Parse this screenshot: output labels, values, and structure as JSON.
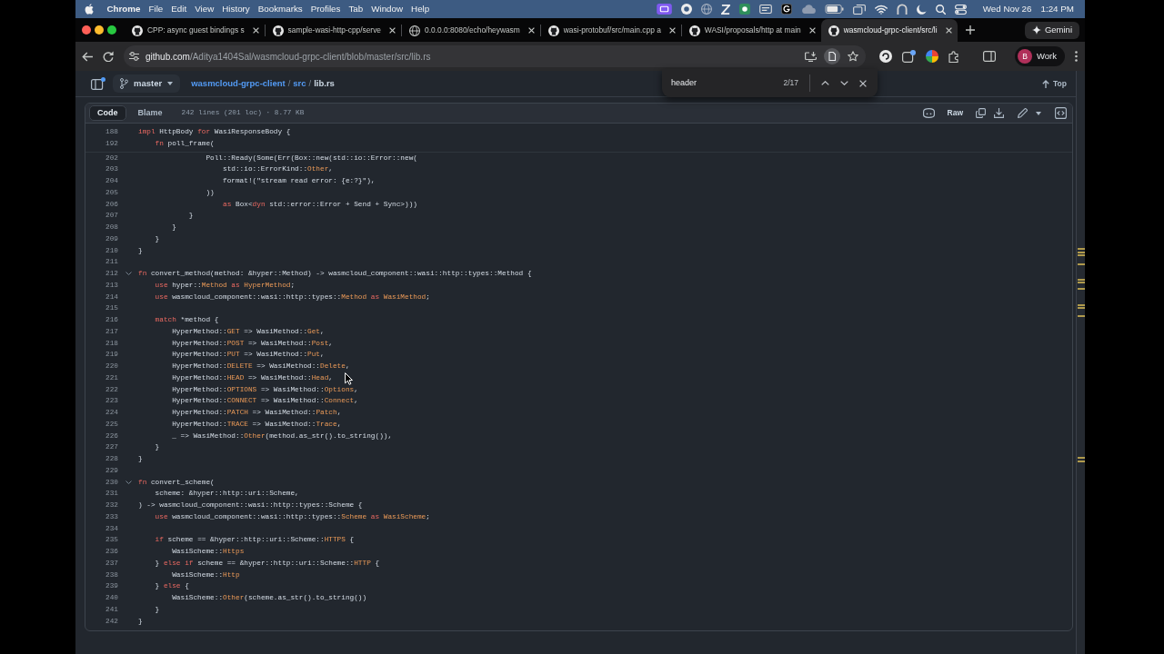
{
  "menu_bar": {
    "app": "Chrome",
    "menus": [
      "File",
      "Edit",
      "View",
      "History",
      "Bookmarks",
      "Profiles",
      "Tab",
      "Window",
      "Help"
    ],
    "date": "Wed Nov 26",
    "time": "1:24 PM"
  },
  "tabs": [
    {
      "title": "CPP: async guest bindings s",
      "kind": "favicon",
      "selected": false
    },
    {
      "title": "sample-wasi-http-cpp/serve",
      "kind": "favicon",
      "selected": false
    },
    {
      "title": "0.0.0.0:8080/echo/heywasm",
      "kind": "generic",
      "selected": false
    },
    {
      "title": "wasi-protobuf/src/main.cpp a",
      "kind": "favicon",
      "selected": false
    },
    {
      "title": "WASI/proposals/http at main",
      "kind": "favicon",
      "selected": false
    },
    {
      "title": "wasmcloud-grpc-client/src/li",
      "kind": "favicon",
      "selected": true
    }
  ],
  "gemini_button": {
    "label": "Gemini"
  },
  "address_bar": {
    "host": "github.com",
    "path": "/Aditya1404Sal/wasmcloud-grpc-client/blob/master/src/lib.rs"
  },
  "profile": {
    "initial": "B",
    "label": "Work"
  },
  "repo_header": {
    "branch": "master",
    "breadcrumb": [
      {
        "label": "wasmcloud-grpc-client",
        "kind": "link"
      },
      {
        "label": "/",
        "kind": "separator"
      },
      {
        "label": "src",
        "kind": "link"
      },
      {
        "label": "/",
        "kind": "separator"
      },
      {
        "label": "lib.rs",
        "kind": "current"
      }
    ],
    "top_link": "Top"
  },
  "find_bar": {
    "query": "header",
    "count": "2/17"
  },
  "file_header": {
    "views": [
      {
        "label": "Code",
        "selected": true
      },
      {
        "label": "Blame",
        "selected": false
      }
    ],
    "info": "242 lines (201 loc) · 8.77 KB",
    "raw_button": "Raw"
  },
  "code": {
    "sticky_lines": [
      {
        "number": "188",
        "code": [
          {
            "kind": "keyword",
            "text": "impl"
          },
          {
            "kind": "plain",
            "text": " HttpBody "
          },
          {
            "kind": "keyword",
            "text": "for"
          },
          {
            "kind": "plain",
            "text": " WasiResponseBody {"
          }
        ]
      },
      {
        "number": "192",
        "code": [
          {
            "kind": "keyword",
            "text": "    fn"
          },
          {
            "kind": "plain",
            "text": " poll_frame("
          }
        ]
      }
    ],
    "lines": [
      {
        "number": "202",
        "code": [
          {
            "kind": "plain",
            "text": "                Poll::Ready(Some(Err(Box::new(std::io::Error::new("
          }
        ]
      },
      {
        "number": "203",
        "code": [
          {
            "kind": "plain",
            "text": "                    std::io::ErrorKind::"
          },
          {
            "kind": "type",
            "text": "Other"
          },
          {
            "kind": "plain",
            "text": ","
          }
        ]
      },
      {
        "number": "204",
        "code": [
          {
            "kind": "plain",
            "text": "                    format!(\"stream read error: {e:?}\"),"
          }
        ]
      },
      {
        "number": "205",
        "code": [
          {
            "kind": "plain",
            "text": "                ))"
          }
        ]
      },
      {
        "number": "206",
        "code": [
          {
            "kind": "keyword",
            "text": "                    as"
          },
          {
            "kind": "plain",
            "text": " Box<"
          },
          {
            "kind": "keyword",
            "text": "dyn"
          },
          {
            "kind": "plain",
            "text": " std::error::Error + Send + Sync>)))"
          }
        ]
      },
      {
        "number": "207",
        "code": [
          {
            "kind": "plain",
            "text": "            }"
          }
        ]
      },
      {
        "number": "208",
        "code": [
          {
            "kind": "plain",
            "text": "        }"
          }
        ]
      },
      {
        "number": "209",
        "code": [
          {
            "kind": "plain",
            "text": "    }"
          }
        ]
      },
      {
        "number": "210",
        "code": [
          {
            "kind": "plain",
            "text": "}"
          }
        ]
      },
      {
        "number": "211"
      },
      {
        "number": "212",
        "expanded": true,
        "code": [
          {
            "kind": "keyword",
            "text": "fn"
          },
          {
            "kind": "plain",
            "text": " convert_method(method: &hyper::Method) -> wasmcloud_component::wasi::http::types::Method {"
          }
        ]
      },
      {
        "number": "213",
        "code": [
          {
            "kind": "keyword",
            "text": "    use"
          },
          {
            "kind": "plain",
            "text": " hyper::"
          },
          {
            "kind": "type",
            "text": "Method"
          },
          {
            "kind": "keyword",
            "text": " as "
          },
          {
            "kind": "type",
            "text": "HyperMethod"
          },
          {
            "kind": "plain",
            "text": ";"
          }
        ]
      },
      {
        "number": "214",
        "code": [
          {
            "kind": "keyword",
            "text": "    use"
          },
          {
            "kind": "plain",
            "text": " wasmcloud_component::wasi::http::types::"
          },
          {
            "kind": "type",
            "text": "Method"
          },
          {
            "kind": "keyword",
            "text": " as "
          },
          {
            "kind": "type",
            "text": "WasiMethod"
          },
          {
            "kind": "plain",
            "text": ";"
          }
        ]
      },
      {
        "number": "215"
      },
      {
        "number": "216",
        "code": [
          {
            "kind": "keyword",
            "text": "    match"
          },
          {
            "kind": "plain",
            "text": " *method {"
          }
        ]
      },
      {
        "number": "217",
        "code": [
          {
            "kind": "plain",
            "text": "        HyperMethod::"
          },
          {
            "kind": "type",
            "text": "GET"
          },
          {
            "kind": "plain",
            "text": " => WasiMethod::"
          },
          {
            "kind": "type",
            "text": "Get"
          },
          {
            "kind": "plain",
            "text": ","
          }
        ]
      },
      {
        "number": "218",
        "code": [
          {
            "kind": "plain",
            "text": "        HyperMethod::"
          },
          {
            "kind": "type",
            "text": "POST"
          },
          {
            "kind": "plain",
            "text": " => WasiMethod::"
          },
          {
            "kind": "type",
            "text": "Post"
          },
          {
            "kind": "plain",
            "text": ","
          }
        ]
      },
      {
        "number": "219",
        "code": [
          {
            "kind": "plain",
            "text": "        HyperMethod::"
          },
          {
            "kind": "type",
            "text": "PUT"
          },
          {
            "kind": "plain",
            "text": " => WasiMethod::"
          },
          {
            "kind": "type",
            "text": "Put"
          },
          {
            "kind": "plain",
            "text": ","
          }
        ]
      },
      {
        "number": "220",
        "code": [
          {
            "kind": "plain",
            "text": "        HyperMethod::"
          },
          {
            "kind": "type",
            "text": "DELETE"
          },
          {
            "kind": "plain",
            "text": " => WasiMethod::"
          },
          {
            "kind": "type",
            "text": "Delete"
          },
          {
            "kind": "plain",
            "text": ","
          }
        ]
      },
      {
        "number": "221",
        "code": [
          {
            "kind": "plain",
            "text": "        HyperMethod::"
          },
          {
            "kind": "type",
            "text": "HEAD"
          },
          {
            "kind": "plain",
            "text": " => WasiMethod::"
          },
          {
            "kind": "type",
            "text": "Head"
          },
          {
            "kind": "plain",
            "text": ","
          }
        ]
      },
      {
        "number": "222",
        "code": [
          {
            "kind": "plain",
            "text": "        HyperMethod::"
          },
          {
            "kind": "type",
            "text": "OPTIONS"
          },
          {
            "kind": "plain",
            "text": " => WasiMethod::"
          },
          {
            "kind": "type",
            "text": "Options"
          },
          {
            "kind": "plain",
            "text": ","
          }
        ]
      },
      {
        "number": "223",
        "code": [
          {
            "kind": "plain",
            "text": "        HyperMethod::"
          },
          {
            "kind": "type",
            "text": "CONNECT"
          },
          {
            "kind": "plain",
            "text": " => WasiMethod::"
          },
          {
            "kind": "type",
            "text": "Connect"
          },
          {
            "kind": "plain",
            "text": ","
          }
        ]
      },
      {
        "number": "224",
        "code": [
          {
            "kind": "plain",
            "text": "        HyperMethod::"
          },
          {
            "kind": "type",
            "text": "PATCH"
          },
          {
            "kind": "plain",
            "text": " => WasiMethod::"
          },
          {
            "kind": "type",
            "text": "Patch"
          },
          {
            "kind": "plain",
            "text": ","
          }
        ]
      },
      {
        "number": "225",
        "code": [
          {
            "kind": "plain",
            "text": "        HyperMethod::"
          },
          {
            "kind": "type",
            "text": "TRACE"
          },
          {
            "kind": "plain",
            "text": " => WasiMethod::"
          },
          {
            "kind": "type",
            "text": "Trace"
          },
          {
            "kind": "plain",
            "text": ","
          }
        ]
      },
      {
        "number": "226",
        "code": [
          {
            "kind": "plain",
            "text": "        _ => WasiMethod::"
          },
          {
            "kind": "type",
            "text": "Other"
          },
          {
            "kind": "plain",
            "text": "(method.as_str().to_string()),"
          }
        ]
      },
      {
        "number": "227",
        "code": [
          {
            "kind": "plain",
            "text": "    }"
          }
        ]
      },
      {
        "number": "228",
        "code": [
          {
            "kind": "plain",
            "text": "}"
          }
        ]
      },
      {
        "number": "229"
      },
      {
        "number": "230",
        "expanded": true,
        "code": [
          {
            "kind": "keyword",
            "text": "fn"
          },
          {
            "kind": "plain",
            "text": " convert_scheme("
          }
        ]
      },
      {
        "number": "231",
        "code": [
          {
            "kind": "plain",
            "text": "    scheme: &hyper::http::uri::Scheme,"
          }
        ]
      },
      {
        "number": "232",
        "code": [
          {
            "kind": "plain",
            "text": ") -> wasmcloud_component::wasi::http::types::Scheme {"
          }
        ]
      },
      {
        "number": "233",
        "code": [
          {
            "kind": "keyword",
            "text": "    use"
          },
          {
            "kind": "plain",
            "text": " wasmcloud_component::wasi::http::types::"
          },
          {
            "kind": "type",
            "text": "Scheme"
          },
          {
            "kind": "keyword",
            "text": " as "
          },
          {
            "kind": "type",
            "text": "WasiScheme"
          },
          {
            "kind": "plain",
            "text": ";"
          }
        ]
      },
      {
        "number": "234"
      },
      {
        "number": "235",
        "code": [
          {
            "kind": "keyword",
            "text": "    if"
          },
          {
            "kind": "plain",
            "text": " scheme == &hyper::http::uri::Scheme::"
          },
          {
            "kind": "type",
            "text": "HTTPS"
          },
          {
            "kind": "plain",
            "text": " {"
          }
        ]
      },
      {
        "number": "236",
        "code": [
          {
            "kind": "plain",
            "text": "        WasiScheme::"
          },
          {
            "kind": "type",
            "text": "Https"
          }
        ]
      },
      {
        "number": "237",
        "code": [
          {
            "kind": "plain",
            "text": "    } "
          },
          {
            "kind": "keyword",
            "text": "else if"
          },
          {
            "kind": "plain",
            "text": " scheme == &hyper::http::uri::Scheme::"
          },
          {
            "kind": "type",
            "text": "HTTP"
          },
          {
            "kind": "plain",
            "text": " {"
          }
        ]
      },
      {
        "number": "238",
        "code": [
          {
            "kind": "plain",
            "text": "        WasiScheme::"
          },
          {
            "kind": "type",
            "text": "Http"
          }
        ]
      },
      {
        "number": "239",
        "code": [
          {
            "kind": "plain",
            "text": "    } "
          },
          {
            "kind": "keyword",
            "text": "else"
          },
          {
            "kind": "plain",
            "text": " {"
          }
        ]
      },
      {
        "number": "240",
        "code": [
          {
            "kind": "plain",
            "text": "        WasiScheme::"
          },
          {
            "kind": "type",
            "text": "Other"
          },
          {
            "kind": "plain",
            "text": "(scheme.as_str().to_string())"
          }
        ]
      },
      {
        "number": "241",
        "code": [
          {
            "kind": "plain",
            "text": "    }"
          }
        ]
      },
      {
        "number": "242",
        "code": [
          {
            "kind": "plain",
            "text": "}"
          }
        ]
      }
    ]
  }
}
